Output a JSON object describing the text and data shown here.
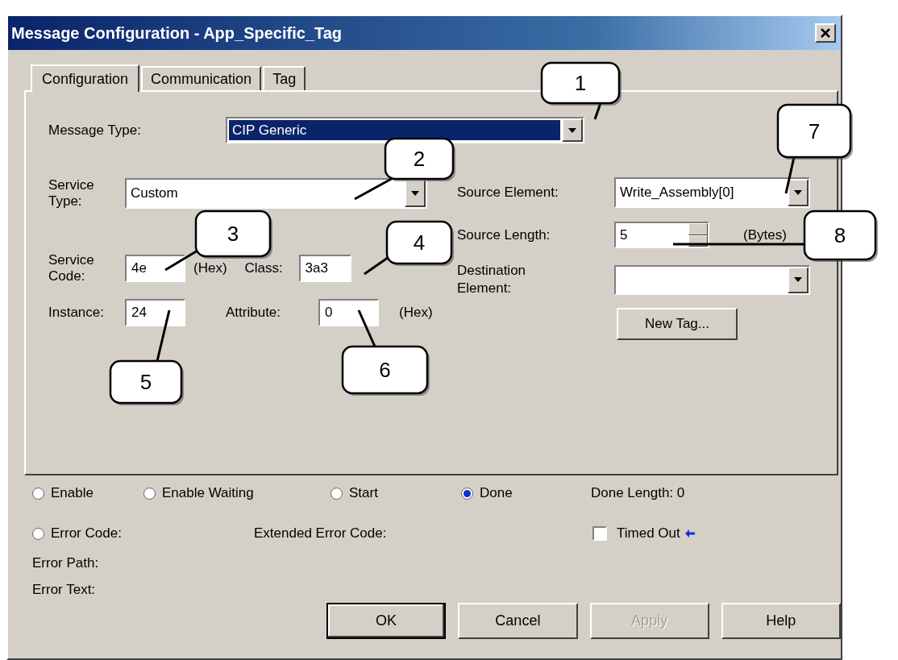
{
  "window": {
    "title": "Message Configuration - App_Specific_Tag"
  },
  "tabs": [
    {
      "label": "Configuration",
      "selected": true
    },
    {
      "label": "Communication",
      "selected": false
    },
    {
      "label": "Tag",
      "selected": false
    }
  ],
  "message_type": {
    "label": "Message Type:",
    "value": "CIP Generic",
    "focused": true
  },
  "service_type": {
    "label": "Service Type:",
    "value": "Custom"
  },
  "service_code": {
    "label": "Service Code:",
    "value": "4e",
    "unit": "(Hex)"
  },
  "class": {
    "label": "Class:",
    "value": "3a3"
  },
  "instance": {
    "label": "Instance:",
    "value": "24"
  },
  "attribute": {
    "label": "Attribute:",
    "value": "0",
    "unit": "(Hex)"
  },
  "source_element": {
    "label": "Source Element:",
    "value": "Write_Assembly[0]"
  },
  "source_length": {
    "label": "Source Length:",
    "value": "5",
    "unit": "(Bytes)"
  },
  "destination_element": {
    "label": "Destination Element:"
  },
  "new_tag_button": {
    "label": "New Tag..."
  },
  "status": [
    {
      "label": "Enable",
      "selected": false
    },
    {
      "label": "Enable Waiting",
      "selected": false
    },
    {
      "label": "Start",
      "selected": false
    },
    {
      "label": "Done",
      "selected": true
    }
  ],
  "done_length": {
    "label": "Done Length:",
    "value": "0"
  },
  "error_code": {
    "label": "Error Code:",
    "selected": false
  },
  "extended_error_code": {
    "label": "Extended Error Code:"
  },
  "timed_out": {
    "label": "Timed Out",
    "checked": false
  },
  "error_path": {
    "label": "Error Path:"
  },
  "error_text": {
    "label": "Error Text:"
  },
  "buttons": [
    {
      "label": "OK",
      "default": true,
      "disabled": false
    },
    {
      "label": "Cancel",
      "default": false,
      "disabled": false
    },
    {
      "label": "Apply",
      "default": false,
      "disabled": true
    },
    {
      "label": "Help",
      "default": false,
      "disabled": false
    }
  ],
  "callouts": [
    {
      "number": "1"
    },
    {
      "number": "2"
    },
    {
      "number": "3"
    },
    {
      "number": "4"
    },
    {
      "number": "5"
    },
    {
      "number": "6"
    },
    {
      "number": "7"
    },
    {
      "number": "8"
    }
  ]
}
